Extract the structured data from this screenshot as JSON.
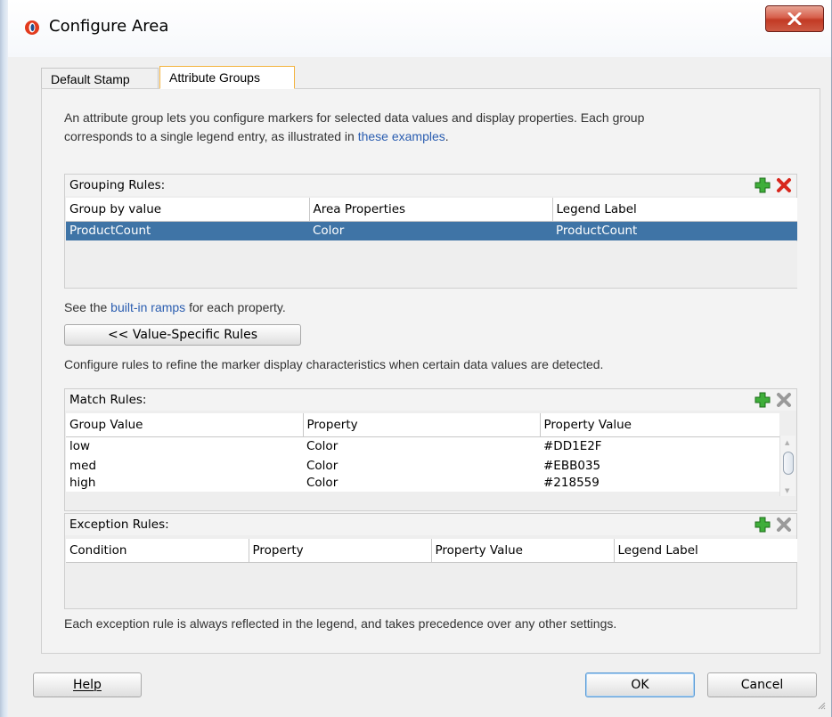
{
  "window": {
    "title": "Configure Area",
    "close_label": "X"
  },
  "tabs": [
    {
      "label": "Default Stamp",
      "selected": false
    },
    {
      "label": "Attribute Groups",
      "selected": true
    }
  ],
  "intro": {
    "line1": "An attribute group lets you configure markers for selected data values and display properties. Each group",
    "line2_before": "corresponds to a single legend entry, as illustrated in ",
    "line2_link": "these examples",
    "line2_after": "."
  },
  "grouping_rules": {
    "title": "Grouping Rules:",
    "columns": [
      "Group by value",
      "Area Properties",
      "Legend Label"
    ],
    "rows": [
      [
        "ProductCount",
        "Color",
        "ProductCount"
      ]
    ]
  },
  "ramps_note": {
    "before": "See the ",
    "link": "built-in ramps",
    "after": " for each property."
  },
  "value_specific_button": "<< Value-Specific Rules",
  "refine_note": "Configure rules to refine the marker display characteristics when certain data values are detected.",
  "match_rules": {
    "title": "Match Rules:",
    "columns": [
      "Group Value",
      "Property",
      "Property Value"
    ],
    "rows": [
      [
        "low",
        "Color",
        "#DD1E2F"
      ],
      [
        "med",
        "Color",
        "#EBB035"
      ],
      [
        "high",
        "Color",
        "#218559"
      ]
    ]
  },
  "exception_rules": {
    "title": "Exception Rules:",
    "columns": [
      "Condition",
      "Property",
      "Property Value",
      "Legend Label"
    ],
    "rows": []
  },
  "exception_note": "Each exception rule is always reflected in the legend, and takes precedence over any other settings.",
  "footer": {
    "help": "Help",
    "ok": "OK",
    "cancel": "Cancel"
  },
  "colors": {
    "selection": "#3f74a6",
    "link": "#2a5db0",
    "tab_highlight": "#f3b33d",
    "add_green": "#2e9b2e",
    "delete_red": "#d8261c"
  },
  "icons": {
    "app": "oracle-logo-icon",
    "add": "plus-icon",
    "delete": "delete-x-icon"
  }
}
